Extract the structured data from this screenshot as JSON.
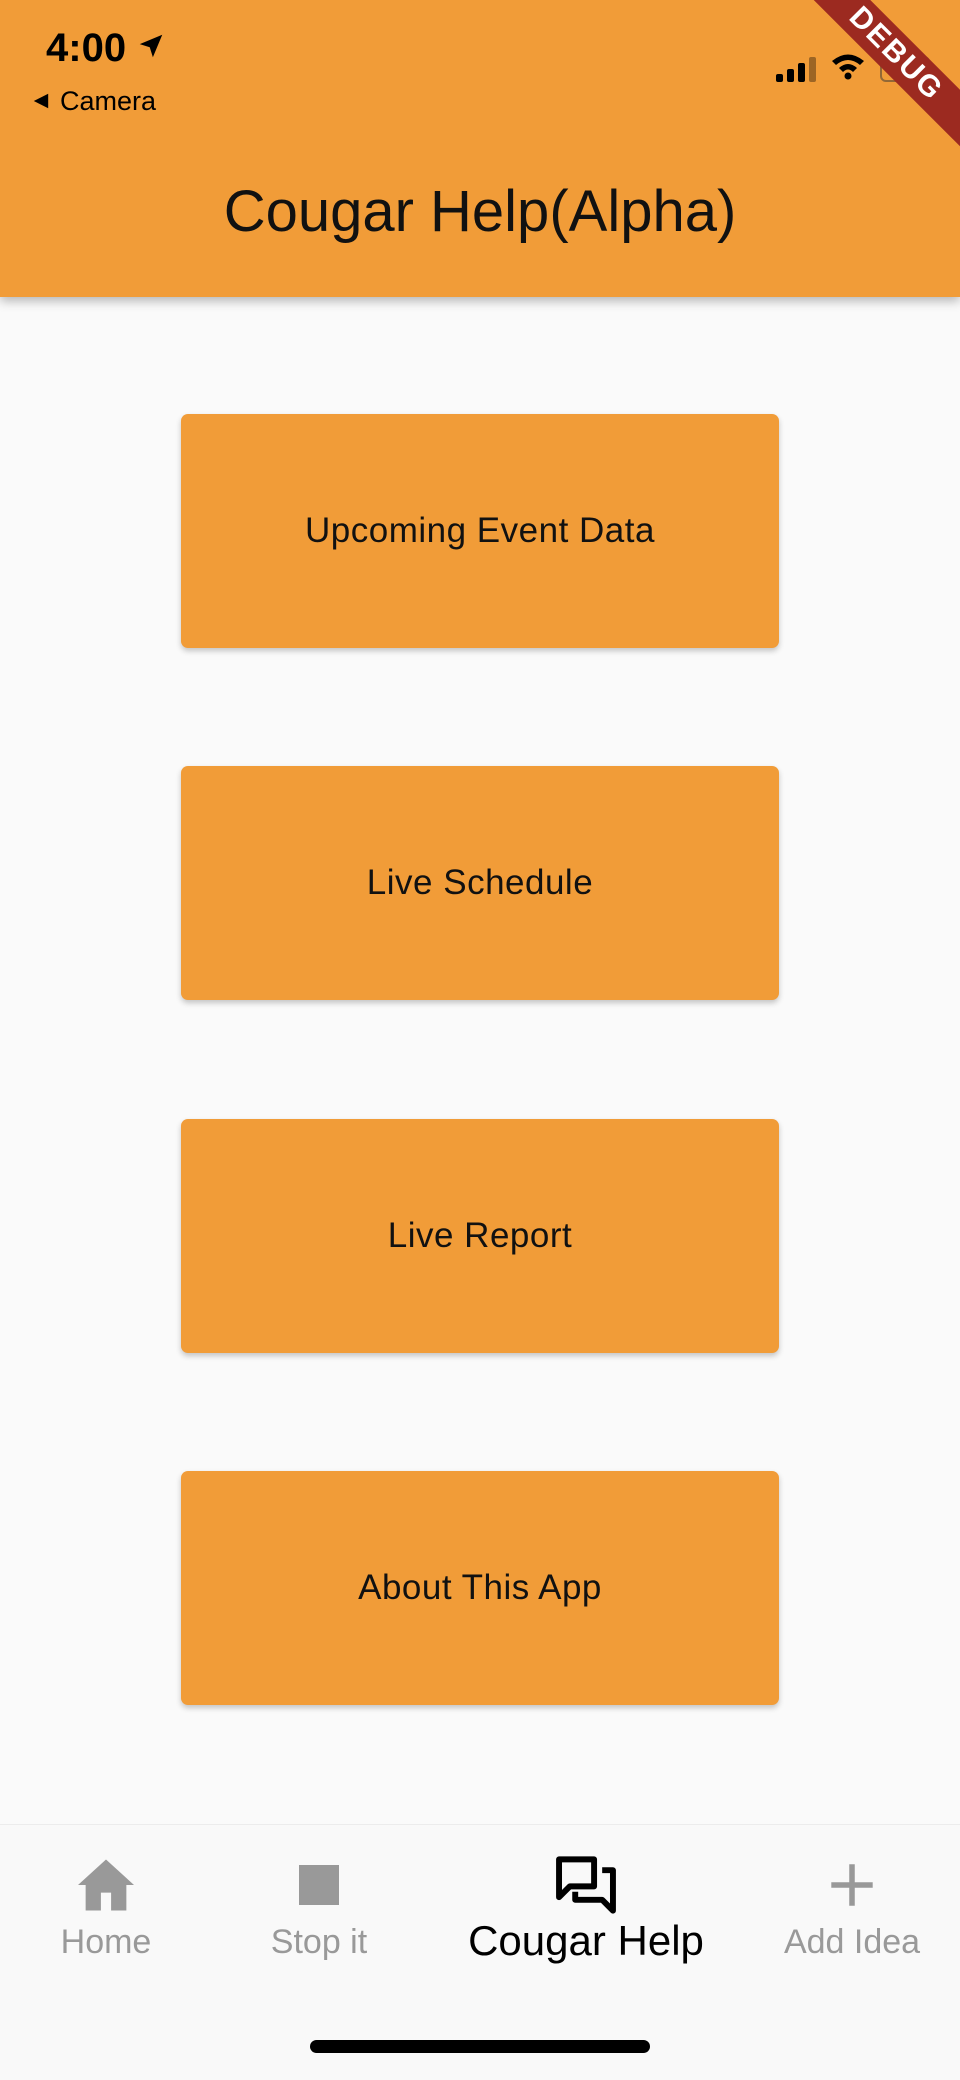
{
  "status_bar": {
    "time": "4:00",
    "back_label": "Camera"
  },
  "app_bar": {
    "title": "Cougar Help(Alpha)",
    "debug_banner": "DEBUG",
    "color": "#f19c38"
  },
  "menu": {
    "buttons": [
      {
        "label": "Upcoming Event Data"
      },
      {
        "label": "Live Schedule"
      },
      {
        "label": "Live Report"
      },
      {
        "label": "About This App"
      }
    ]
  },
  "bottom_nav": {
    "items": [
      {
        "label": "Home",
        "icon": "home-icon"
      },
      {
        "label": "Stop it",
        "icon": "stop-icon"
      },
      {
        "label": "Cougar Help",
        "icon": "chat-bubbles-icon",
        "active": true
      },
      {
        "label": "Add Idea",
        "icon": "plus-icon"
      }
    ]
  }
}
